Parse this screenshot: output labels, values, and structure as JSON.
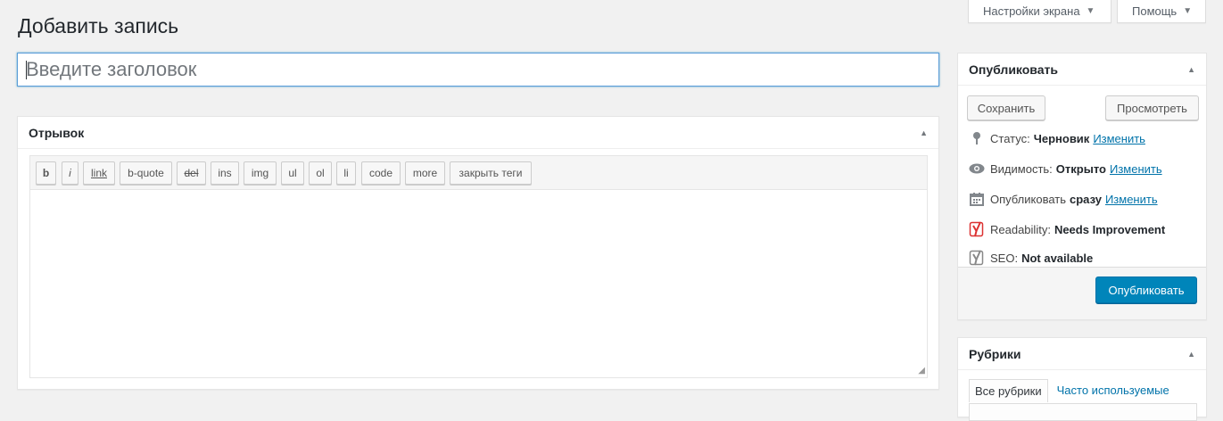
{
  "topbar": {
    "screen_options_label": "Настройки экрана",
    "help_label": "Помощь"
  },
  "page_title": "Добавить запись",
  "title_field": {
    "placeholder": "Введите заголовок",
    "value": ""
  },
  "excerpt": {
    "heading": "Отрывок",
    "toolbar": [
      "b",
      "i",
      "link",
      "b-quote",
      "del",
      "ins",
      "img",
      "ul",
      "ol",
      "li",
      "code",
      "more",
      "закрыть теги"
    ],
    "value": ""
  },
  "publish": {
    "heading": "Опубликовать",
    "save_label": "Сохранить",
    "preview_label": "Просмотреть",
    "status_label": "Статус:",
    "status_value": "Черновик",
    "visibility_label": "Видимость:",
    "visibility_value": "Открыто",
    "schedule_label": "Опубликовать",
    "schedule_value": "сразу",
    "edit_label": "Изменить",
    "readability_label": "Readability:",
    "readability_value": "Needs Improvement",
    "seo_label": "SEO:",
    "seo_value": "Not available",
    "publish_label": "Опубликовать",
    "icons": [
      "pin-icon",
      "eye-icon",
      "calendar-icon",
      "yoast-readability-icon",
      "yoast-seo-icon"
    ]
  },
  "categories": {
    "heading": "Рубрики",
    "tabs": [
      "Все рубрики",
      "Часто используемые"
    ]
  },
  "colors": {
    "accent": "#0085ba",
    "link": "#0073aa",
    "focus_border": "#5b9dd9",
    "background": "#f1f1f1",
    "readability_bad": "#dc3232"
  }
}
